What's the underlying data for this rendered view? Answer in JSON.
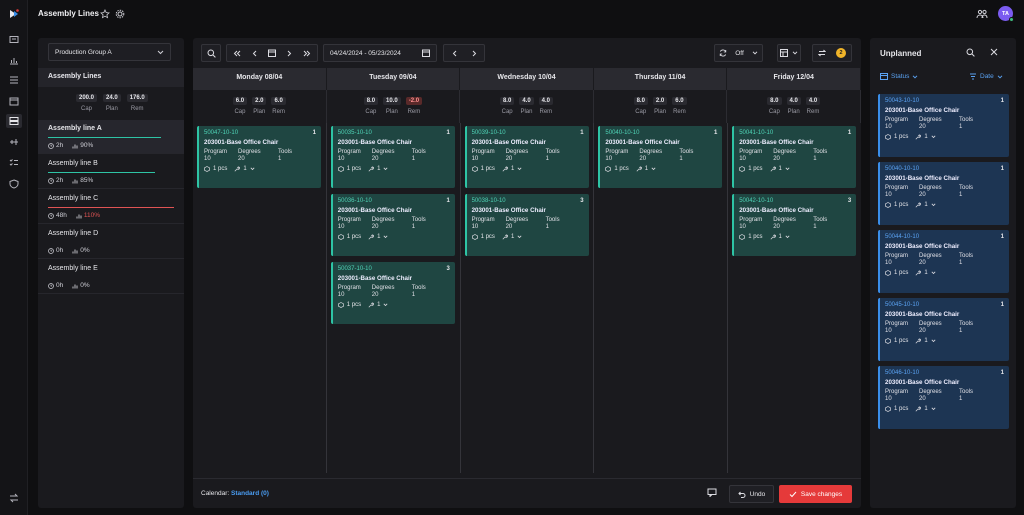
{
  "app": {
    "title": "Assembly Lines",
    "avatar_initials": "TA",
    "accent": "#e53a3a",
    "teal": "#2ec4a5",
    "blue": "#3a8eea"
  },
  "left": {
    "group": "Production Group A",
    "header": "Assembly Lines",
    "cap_labels": [
      "Cap",
      "Plan",
      "Rem"
    ],
    "cap_values": [
      "200.0",
      "24.0",
      "176.0"
    ],
    "lines": [
      {
        "name": "Assembly line A",
        "hours": "2h",
        "pct": "90%",
        "load": 0.9,
        "color": "#2ec4a5",
        "pct_color": "#cfcfd6"
      },
      {
        "name": "Assembly line B",
        "hours": "2h",
        "pct": "85%",
        "load": 0.85,
        "color": "#2ec4a5",
        "pct_color": "#cfcfd6"
      },
      {
        "name": "Assembly line C",
        "hours": "48h",
        "pct": "110%",
        "load": 1.0,
        "color": "#e05454",
        "pct_color": "#e05454"
      },
      {
        "name": "Assembly line D",
        "hours": "0h",
        "pct": "0%",
        "load": 0,
        "color": "#2ec4a5",
        "pct_color": "#cfcfd6"
      },
      {
        "name": "Assembly line E",
        "hours": "0h",
        "pct": "0%",
        "load": 0,
        "color": "#2ec4a5",
        "pct_color": "#cfcfd6"
      }
    ]
  },
  "toolbar": {
    "date_range": "04/24/2024 - 05/23/2024",
    "sync_mode": "Off",
    "badge_count": "2"
  },
  "days": [
    {
      "label": "Monday 08/04",
      "cap": "6.0",
      "plan": "2.0",
      "rem": "6.0",
      "rem_neg": false
    },
    {
      "label": "Tuesday 09/04",
      "cap": "8.0",
      "plan": "10.0",
      "rem": "-2.0",
      "rem_neg": true
    },
    {
      "label": "Wednesday 10/04",
      "cap": "8.0",
      "plan": "4.0",
      "rem": "4.0",
      "rem_neg": false
    },
    {
      "label": "Thursday 11/04",
      "cap": "8.0",
      "plan": "2.0",
      "rem": "6.0",
      "rem_neg": false
    },
    {
      "label": "Friday 12/04",
      "cap": "8.0",
      "plan": "4.0",
      "rem": "4.0",
      "rem_neg": false
    }
  ],
  "card_labels": {
    "program": "Program",
    "degrees": "Degrees",
    "tools": "Tools"
  },
  "columns": [
    [
      {
        "id": "50047-10-10",
        "qty": "1",
        "product": "203001-Base Office Chair",
        "program": "10",
        "degrees": "20",
        "tools": "1",
        "pcs": "1 pcs",
        "tool_count": "1"
      }
    ],
    [
      {
        "id": "50035-10-10",
        "qty": "1",
        "product": "203001-Base Office Chair",
        "program": "10",
        "degrees": "20",
        "tools": "1",
        "pcs": "1 pcs",
        "tool_count": "1"
      },
      {
        "id": "50036-10-10",
        "qty": "1",
        "product": "203001-Base Office Chair",
        "program": "10",
        "degrees": "20",
        "tools": "1",
        "pcs": "1 pcs",
        "tool_count": "1"
      },
      {
        "id": "50037-10-10",
        "qty": "3",
        "product": "203001-Base Office Chair",
        "program": "10",
        "degrees": "20",
        "tools": "1",
        "pcs": "1 pcs",
        "tool_count": "1"
      }
    ],
    [
      {
        "id": "50039-10-10",
        "qty": "1",
        "product": "203001-Base Office Chair",
        "program": "10",
        "degrees": "20",
        "tools": "1",
        "pcs": "1 pcs",
        "tool_count": "1"
      },
      {
        "id": "50038-10-10",
        "qty": "3",
        "product": "203001-Base Office Chair",
        "program": "10",
        "degrees": "20",
        "tools": "1",
        "pcs": "1 pcs",
        "tool_count": "1"
      }
    ],
    [
      {
        "id": "50040-10-10",
        "qty": "1",
        "product": "203001-Base Office Chair",
        "program": "10",
        "degrees": "20",
        "tools": "1",
        "pcs": "1 pcs",
        "tool_count": "1"
      }
    ],
    [
      {
        "id": "50041-10-10",
        "qty": "1",
        "product": "203001-Base Office Chair",
        "program": "10",
        "degrees": "20",
        "tools": "1",
        "pcs": "1 pcs",
        "tool_count": "1"
      },
      {
        "id": "50042-10-10",
        "qty": "3",
        "product": "203001-Base Office Chair",
        "program": "10",
        "degrees": "20",
        "tools": "1",
        "pcs": "1 pcs",
        "tool_count": "1"
      }
    ]
  ],
  "footer": {
    "calendar_label": "Calendar:",
    "calendar_value": "Standard (0)",
    "undo": "Undo",
    "save": "Save changes"
  },
  "unplanned": {
    "title": "Unplanned",
    "status_filter": "Status",
    "date_sort": "Date",
    "items": [
      {
        "id": "50043-10-10",
        "qty": "1",
        "product": "203001-Base Office Chair",
        "program": "10",
        "degrees": "20",
        "tools": "1",
        "pcs": "1 pcs",
        "tool_count": "1"
      },
      {
        "id": "50040-10-10",
        "qty": "1",
        "product": "203001-Base Office Chair",
        "program": "10",
        "degrees": "20",
        "tools": "1",
        "pcs": "1 pcs",
        "tool_count": "1"
      },
      {
        "id": "50044-10-10",
        "qty": "1",
        "product": "203001-Base Office Chair",
        "program": "10",
        "degrees": "20",
        "tools": "1",
        "pcs": "1 pcs",
        "tool_count": "1"
      },
      {
        "id": "50045-10-10",
        "qty": "1",
        "product": "203001-Base Office Chair",
        "program": "10",
        "degrees": "20",
        "tools": "1",
        "pcs": "1 pcs",
        "tool_count": "1"
      },
      {
        "id": "50046-10-10",
        "qty": "1",
        "product": "203001-Base Office Chair",
        "program": "10",
        "degrees": "20",
        "tools": "1",
        "pcs": "1 pcs",
        "tool_count": "1"
      }
    ]
  },
  "icons": [
    "logo-icon",
    "inbox-icon",
    "chart-icon",
    "list-icon",
    "calendar-icon",
    "lines-icon",
    "sliders-icon",
    "checklist-icon",
    "shield-icon",
    "swap-icon",
    "star-icon",
    "gear-icon",
    "people-icon",
    "search-icon",
    "refresh-icon",
    "filter-icon",
    "close-icon"
  ]
}
